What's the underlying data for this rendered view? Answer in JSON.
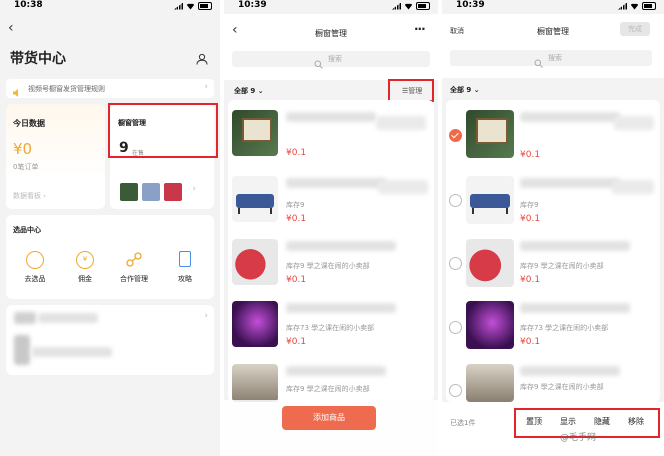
{
  "screen1": {
    "time": "10:38",
    "title": "带货中心",
    "notice": "视频号橱窗发货管理规则",
    "today": {
      "title": "今日数据",
      "amount": "¥0",
      "orders": "0笔订单",
      "link": "数据看板"
    },
    "showcase": {
      "title": "橱窗管理",
      "count": "9",
      "unit": "在售"
    },
    "select_center": {
      "title": "选品中心",
      "items": [
        {
          "label": "去选品",
          "icon": "select-product-icon"
        },
        {
          "label": "佣金",
          "icon": "commission-icon"
        },
        {
          "label": "合作管理",
          "icon": "cooperation-icon"
        },
        {
          "label": "攻略",
          "icon": "guide-icon"
        }
      ]
    }
  },
  "screen2": {
    "time": "10:39",
    "title": "橱窗管理",
    "search_placeholder": "搜索",
    "filter": "全部 9",
    "manage": "管理",
    "items": [
      {
        "price": "¥0.1",
        "sub": ""
      },
      {
        "price": "¥0.1",
        "sub": "库存9"
      },
      {
        "price": "¥0.1",
        "sub": "库存9   學之课在闹的小卖部"
      },
      {
        "price": "¥0.1",
        "sub": "库存73   學之课在闹的小卖部"
      },
      {
        "price": "¥0.1",
        "sub": "库存9   學之课在闹的小卖部"
      }
    ],
    "add_button": "添加商品"
  },
  "screen3": {
    "time": "10:39",
    "cancel": "取消",
    "title": "橱窗管理",
    "done": "完成",
    "search_placeholder": "搜索",
    "filter": "全部 9",
    "items": [
      {
        "price": "¥0.1",
        "sub": "",
        "checked": true
      },
      {
        "price": "¥0.1",
        "sub": "库存9",
        "checked": false
      },
      {
        "price": "¥0.1",
        "sub": "库存9   學之课在闹的小卖部",
        "checked": false
      },
      {
        "price": "¥0.1",
        "sub": "库存73   學之课在闹的小卖部",
        "checked": false
      },
      {
        "price": "",
        "sub": "库存9   學之课在闹的小卖部",
        "checked": false
      }
    ],
    "selected": "已选1件",
    "actions": [
      "置顶",
      "显示",
      "隐藏",
      "移除"
    ]
  },
  "watermark": "@毛手网",
  "colors": {
    "accent": "#e8473b",
    "highlight": "#e0262b",
    "orange": "#f0a830"
  }
}
